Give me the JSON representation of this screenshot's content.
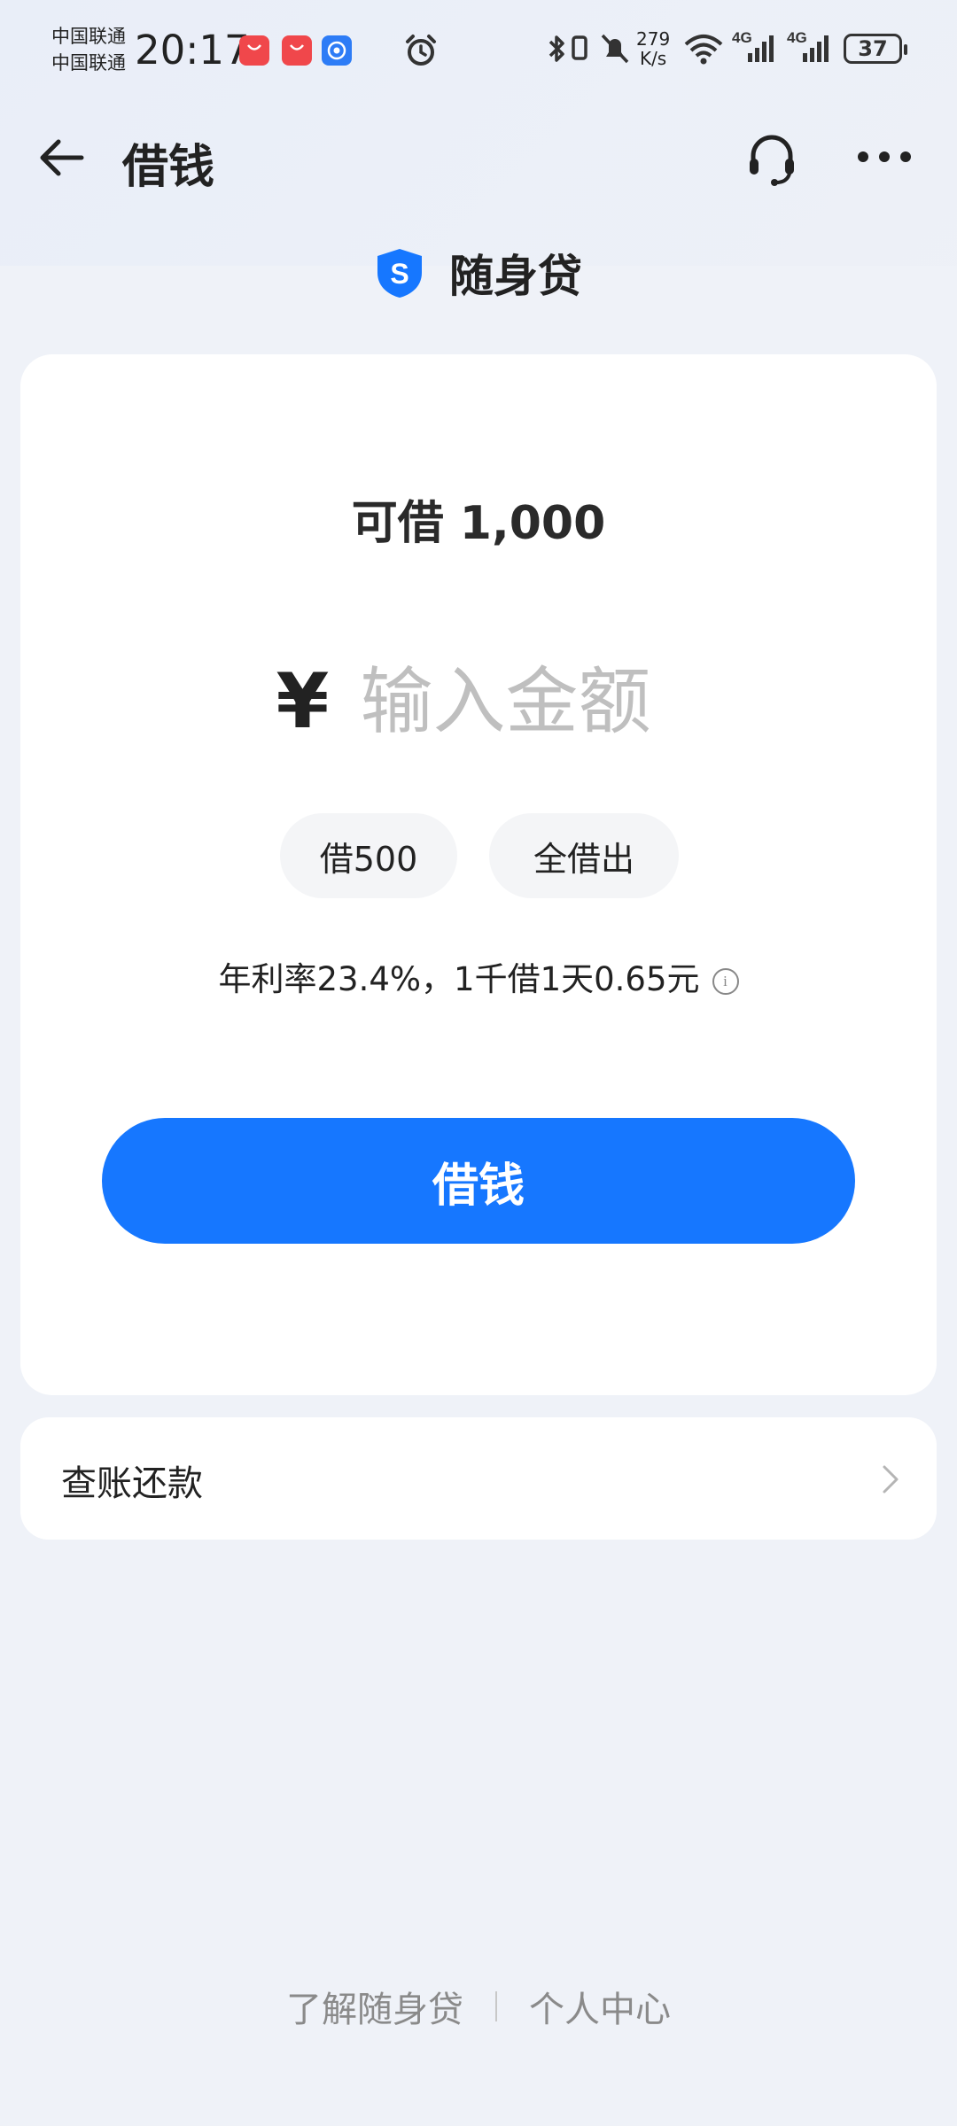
{
  "status_bar": {
    "carrier_1": "中国联通",
    "carrier_2": "中国联通",
    "time": "20:17",
    "net_speed_value": "279",
    "net_speed_unit": "K/s",
    "network_1": "4G",
    "network_2": "4G",
    "battery": "37",
    "icons": [
      "huawei-appgallery-icon",
      "huawei-appgallery-icon",
      "app-shortcut-icon",
      "alarm-icon",
      "bluetooth-icon",
      "vibrate-icon",
      "mute-icon",
      "wifi-icon",
      "signal-icon",
      "battery-icon"
    ]
  },
  "header": {
    "title": "借钱",
    "back_icon": "arrow-left-icon",
    "service_icon": "headset-icon",
    "more_icon": "more-dots-icon"
  },
  "brand": {
    "logo_letter": "S",
    "name": "随身贷",
    "logo_color": "#1677ff"
  },
  "loan": {
    "available_label": "可借 1,000",
    "currency_symbol": "¥",
    "amount_placeholder": "输入金额",
    "quick_options": [
      "借500",
      "全借出"
    ],
    "rate_text": "年利率23.4%，1千借1天0.65元",
    "info_icon_glyph": "i",
    "borrow_button": "借钱",
    "accent_color": "#1677ff"
  },
  "menu": {
    "bills_label": "查账还款"
  },
  "footer": {
    "link_1": "了解随身贷",
    "link_2": "个人中心"
  }
}
